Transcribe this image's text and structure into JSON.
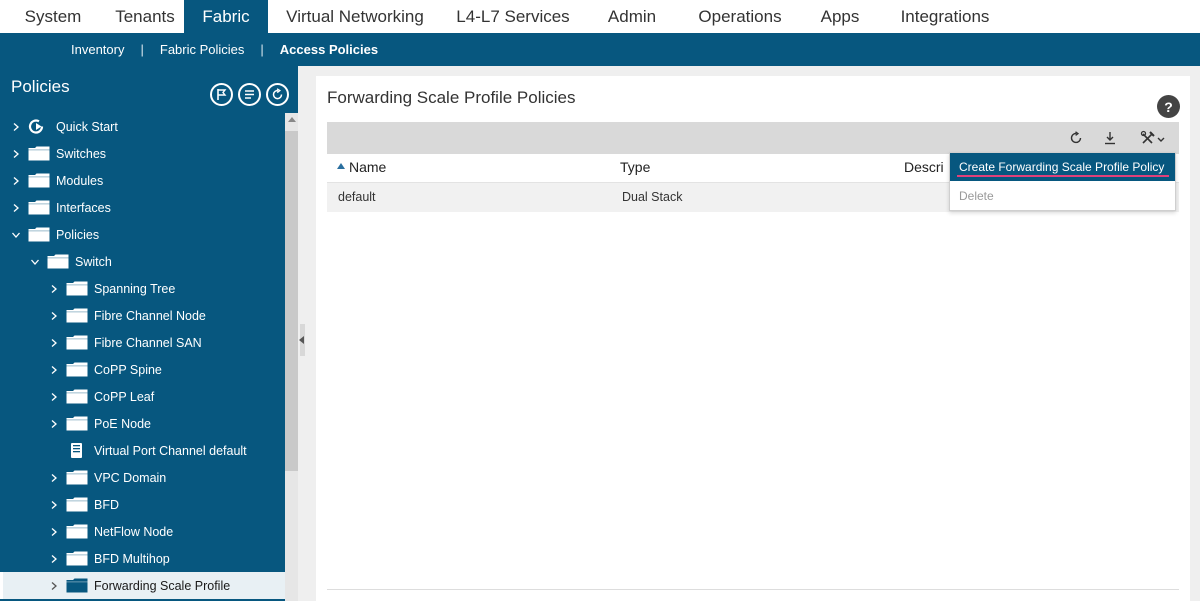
{
  "top_nav": {
    "tabs": [
      {
        "label": "System"
      },
      {
        "label": "Tenants"
      },
      {
        "label": "Fabric",
        "active": true
      },
      {
        "label": "Virtual Networking"
      },
      {
        "label": "L4-L7 Services"
      },
      {
        "label": "Admin"
      },
      {
        "label": "Operations"
      },
      {
        "label": "Apps"
      },
      {
        "label": "Integrations"
      }
    ]
  },
  "sub_nav": {
    "items": [
      {
        "label": "Inventory"
      },
      {
        "label": "Fabric Policies"
      },
      {
        "label": "Access Policies",
        "active": true
      }
    ],
    "separator": "|"
  },
  "sidebar": {
    "title": "Policies",
    "tree": [
      {
        "label": "Quick Start",
        "icon": "quick-start-icon",
        "expanded": false
      },
      {
        "label": "Switches",
        "icon": "folder-icon",
        "expanded": false
      },
      {
        "label": "Modules",
        "icon": "folder-icon",
        "expanded": false
      },
      {
        "label": "Interfaces",
        "icon": "folder-icon",
        "expanded": false
      },
      {
        "label": "Policies",
        "icon": "folder-icon",
        "expanded": true
      },
      {
        "label": "Switch",
        "icon": "folder-icon",
        "expanded": true
      },
      {
        "label": "Spanning Tree",
        "icon": "folder-icon",
        "expanded": false
      },
      {
        "label": "Fibre Channel Node",
        "icon": "folder-icon",
        "expanded": false
      },
      {
        "label": "Fibre Channel SAN",
        "icon": "folder-icon",
        "expanded": false
      },
      {
        "label": "CoPP Spine",
        "icon": "folder-icon",
        "expanded": false
      },
      {
        "label": "CoPP Leaf",
        "icon": "folder-icon",
        "expanded": false
      },
      {
        "label": "PoE Node",
        "icon": "folder-icon",
        "expanded": false
      },
      {
        "label": "Virtual Port Channel default",
        "icon": "document-icon"
      },
      {
        "label": "VPC Domain",
        "icon": "folder-icon",
        "expanded": false
      },
      {
        "label": "BFD",
        "icon": "folder-icon",
        "expanded": false
      },
      {
        "label": "NetFlow Node",
        "icon": "folder-icon",
        "expanded": false
      },
      {
        "label": "BFD Multihop",
        "icon": "folder-icon",
        "expanded": false
      },
      {
        "label": "Forwarding Scale Profile",
        "icon": "folder-icon",
        "expanded": false,
        "selected": true
      }
    ]
  },
  "main": {
    "title": "Forwarding Scale Profile Policies",
    "help": "?",
    "table": {
      "columns": [
        "Name",
        "Type",
        "Descri"
      ],
      "rows": [
        {
          "name": "default",
          "type": "Dual Stack"
        }
      ]
    }
  },
  "dropdown": {
    "items": [
      {
        "label": "Create Forwarding Scale Profile Policy",
        "state": "highlighted"
      },
      {
        "label": "Delete",
        "state": "disabled"
      }
    ]
  },
  "colors": {
    "brand": "#07577f",
    "highlight_underline": "#e0407a"
  }
}
